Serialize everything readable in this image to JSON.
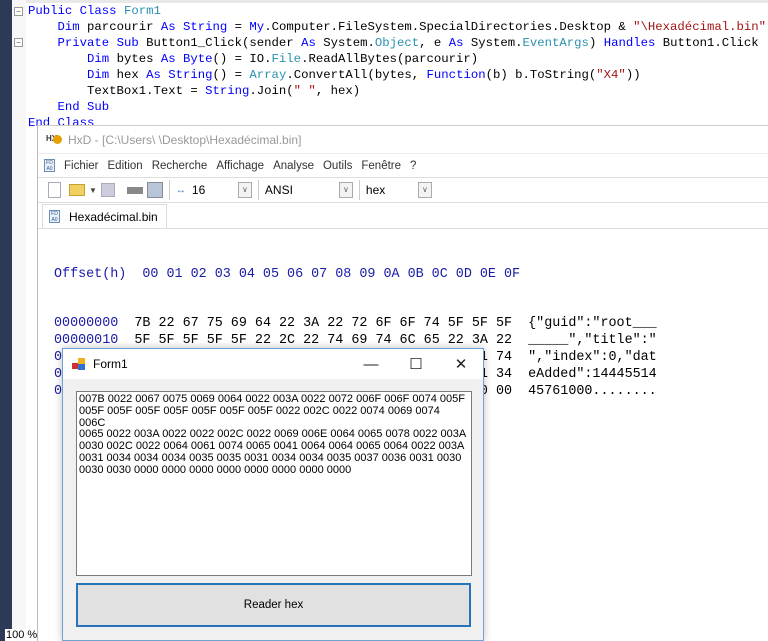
{
  "editor": {
    "code_lines": [
      [
        {
          "t": "Public Class ",
          "c": "kw"
        },
        {
          "t": "Form1",
          "c": "ty"
        }
      ],
      [
        {
          "t": "    "
        },
        {
          "t": "Dim",
          "c": "kw"
        },
        {
          "t": " parcourir "
        },
        {
          "t": "As String",
          "c": "kw"
        },
        {
          "t": " = "
        },
        {
          "t": "My",
          "c": "kw"
        },
        {
          "t": ".Computer.FileSystem.SpecialDirectories.Desktop & "
        },
        {
          "t": "\"\\Hexadécimal.bin\"",
          "c": "st"
        }
      ],
      [
        {
          "t": "    "
        },
        {
          "t": "Private Sub",
          "c": "kw"
        },
        {
          "t": " Button1_Click(sender "
        },
        {
          "t": "As",
          "c": "kw"
        },
        {
          "t": " System."
        },
        {
          "t": "Object",
          "c": "ty"
        },
        {
          "t": ", e "
        },
        {
          "t": "As",
          "c": "kw"
        },
        {
          "t": " System."
        },
        {
          "t": "EventArgs",
          "c": "ty"
        },
        {
          "t": ") "
        },
        {
          "t": "Handles",
          "c": "kw"
        },
        {
          "t": " Button1.Click"
        }
      ],
      [
        {
          "t": "        "
        },
        {
          "t": "Dim",
          "c": "kw"
        },
        {
          "t": " bytes "
        },
        {
          "t": "As Byte",
          "c": "kw"
        },
        {
          "t": "() = IO."
        },
        {
          "t": "File",
          "c": "ty"
        },
        {
          "t": ".ReadAllBytes(parcourir)"
        }
      ],
      [
        {
          "t": "        "
        },
        {
          "t": "Dim",
          "c": "kw"
        },
        {
          "t": " hex "
        },
        {
          "t": "As String",
          "c": "kw"
        },
        {
          "t": "() = "
        },
        {
          "t": "Array",
          "c": "ty"
        },
        {
          "t": ".ConvertAll(bytes, "
        },
        {
          "t": "Function",
          "c": "kw"
        },
        {
          "t": "(b) b.ToString("
        },
        {
          "t": "\"X4\"",
          "c": "st"
        },
        {
          "t": "))"
        }
      ],
      [
        {
          "t": "        TextBox1.Text = "
        },
        {
          "t": "String",
          "c": "kw"
        },
        {
          "t": ".Join("
        },
        {
          "t": "\" \"",
          "c": "st"
        },
        {
          "t": ", hex)"
        }
      ],
      [
        {
          "t": "    "
        },
        {
          "t": "End Sub",
          "c": "kw"
        }
      ],
      [
        {
          "t": "End Class",
          "c": "kw"
        }
      ]
    ],
    "zoom_level": "100 %"
  },
  "hxd": {
    "title": "HxD - [C:\\Users\\        \\Desktop\\Hexadécimal.bin]",
    "menu": [
      "Fichier",
      "Edition",
      "Recherche",
      "Affichage",
      "Analyse",
      "Outils",
      "Fenêtre",
      "?"
    ],
    "bytes_per_row": "16",
    "charset": "ANSI",
    "offset_base": "hex",
    "tab": "Hexadécimal.bin",
    "header": "Offset(h)  00 01 02 03 04 05 06 07 08 09 0A 0B 0C 0D 0E 0F",
    "rows": [
      {
        "offset": "00000000",
        "bytes": "7B 22 67 75 69 64 22 3A 22 72 6F 6F 74 5F 5F 5F",
        "text": "{\"guid\":\"root___"
      },
      {
        "offset": "00000010",
        "bytes": "5F 5F 5F 5F 5F 22 2C 22 74 69 74 6C 65 22 3A 22",
        "text": "_____\",\"title\":\""
      },
      {
        "offset": "00000020",
        "bytes": "22 2C 22 69 6E 64 65 78 22 3A 30 2C 22 64 61 74",
        "text": "\",\"index\":0,\"dat"
      },
      {
        "offset": "00000030",
        "bytes": "65 41 64 64 65 64 22 3A 31 34 34 34 35 35 31 34",
        "text": "eAdded\":14445514"
      },
      {
        "offset": "00000040",
        "bytes": "34 35 37 36 31 30 30 30 00 00 00 00 00 00 00 00",
        "text": "45761000........"
      }
    ]
  },
  "form": {
    "title": "Form1",
    "textbox": "007B 0022 0067 0075 0069 0064 0022 003A 0022 0072 006F 006F 0074 005F\n005F 005F 005F 005F 005F 005F 005F 0022 002C 0022 0074 0069 0074 006C\n0065 0022 003A 0022 0022 002C 0022 0069 006E 0064 0065 0078 0022 003A\n0030 002C 0022 0064 0061 0074 0065 0041 0064 0064 0065 0064 0022 003A\n0031 0034 0034 0034 0035 0035 0031 0034 0034 0035 0037 0036 0031 0030\n0030 0030 0000 0000 0000 0000 0000 0000 0000 0000",
    "button": "Reader hex",
    "minimize": "—",
    "maximize": "☐",
    "close": "✕"
  }
}
